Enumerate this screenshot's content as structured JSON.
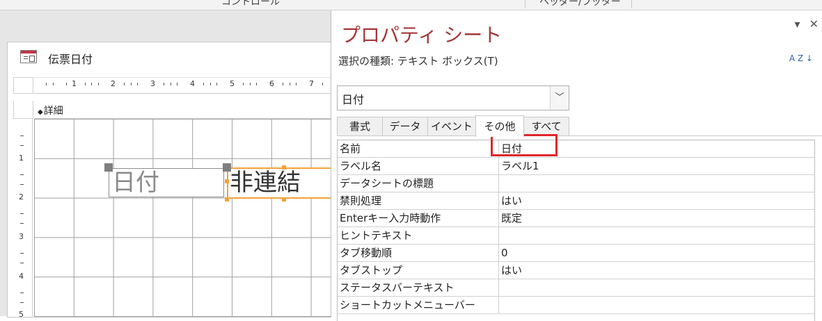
{
  "ribbon": {
    "groups": [
      "コントロール",
      "ヘッダー/フッター"
    ]
  },
  "form": {
    "title": "伝票日付",
    "icon": "form-icon",
    "ruler_top": [
      "1",
      "2",
      "3",
      "4",
      "5",
      "6",
      "7"
    ],
    "ruler_left": [
      "1",
      "2",
      "3",
      "4",
      "5"
    ],
    "section_label": "詳細",
    "controls": {
      "textbox_text": "日付",
      "label_text": "非連結"
    }
  },
  "property_sheet": {
    "title": "プロパティ シート",
    "window_buttons": [
      "▾",
      "✕"
    ],
    "selection_type": "選択の種類:  テキスト ボックス(T)",
    "sort_icon": "sort-az-icon",
    "sort_icon_text": "A Z ↓",
    "selected_control": "日付",
    "tabs": [
      {
        "label": "書式",
        "active": false
      },
      {
        "label": "データ",
        "active": false
      },
      {
        "label": "イベント",
        "active": false
      },
      {
        "label": "その他",
        "active": true
      },
      {
        "label": "すべて",
        "active": false
      }
    ],
    "properties": [
      {
        "name": "名前",
        "value": "日付"
      },
      {
        "name": "ラベル名",
        "value": "ラベル1"
      },
      {
        "name": "データシートの標題",
        "value": ""
      },
      {
        "name": "禁則処理",
        "value": "はい"
      },
      {
        "name": "Enterキー入力時動作",
        "value": "既定"
      },
      {
        "name": "ヒントテキスト",
        "value": ""
      },
      {
        "name": "タブ移動順",
        "value": "0"
      },
      {
        "name": "タブストップ",
        "value": "はい"
      },
      {
        "name": "ステータスバーテキスト",
        "value": ""
      },
      {
        "name": "ショートカットメニューバー",
        "value": ""
      }
    ]
  },
  "colors": {
    "title_red": "#a4373a",
    "selection_orange": "#f2a23a",
    "highlight_red": "#e0252b"
  }
}
